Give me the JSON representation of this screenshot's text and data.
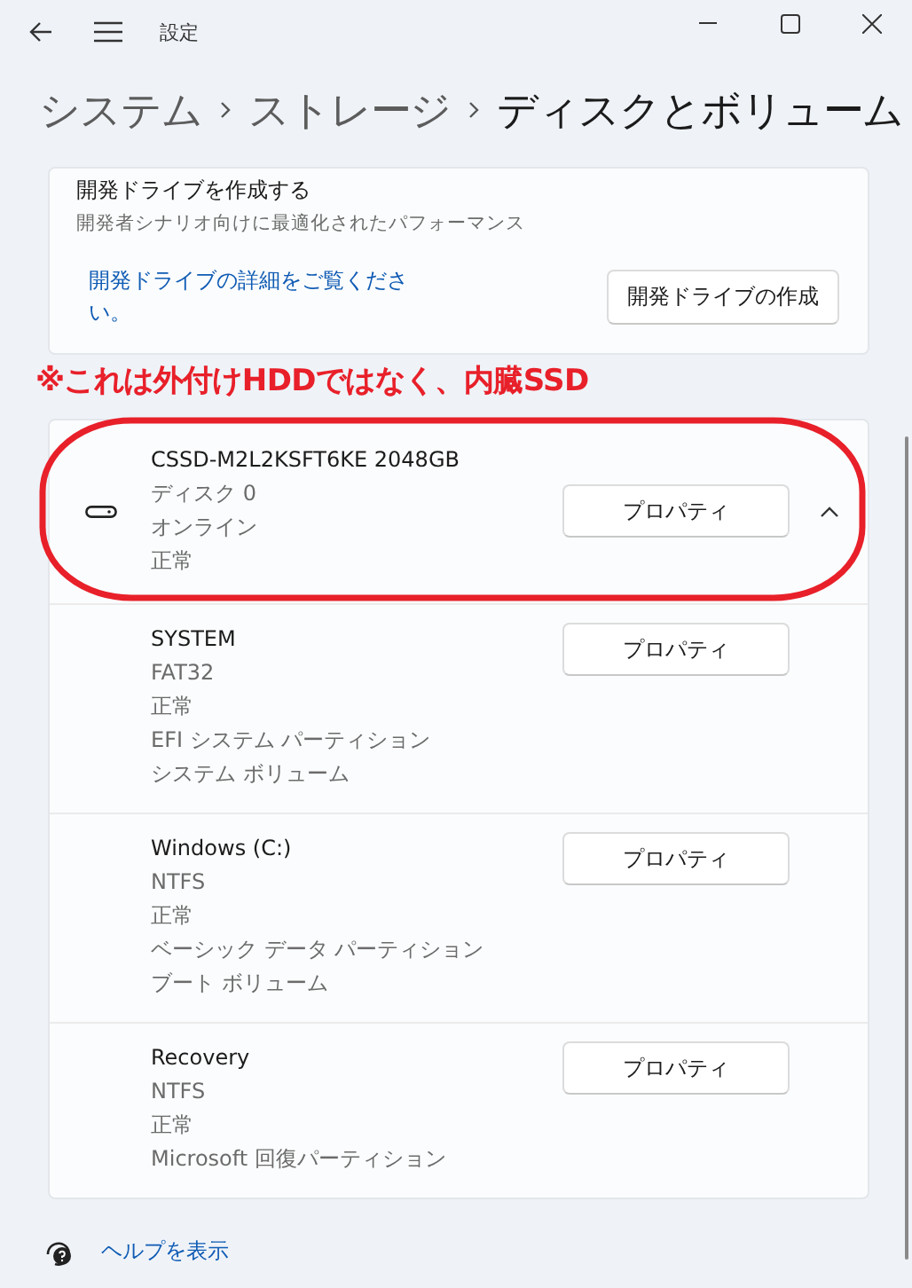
{
  "window": {
    "title": "設定"
  },
  "breadcrumb": [
    "システム",
    "ストレージ",
    "ディスクとボリューム"
  ],
  "dev_drive": {
    "title": "開発ドライブを作成する",
    "subtitle": "開発者シナリオ向けに最適化されたパフォーマンス",
    "link": "開発ドライブの詳細をご覧ください。",
    "button": "開発ドライブの作成"
  },
  "annotation": {
    "text": "※これは外付けHDDではなく、内臓SSD"
  },
  "volumes": [
    {
      "kind": "disk",
      "name": "CSSD-M2L2KSFT6KE 2048GB",
      "details": [
        "ディスク 0",
        "オンライン",
        "正常"
      ],
      "button": "プロパティ",
      "expanded": true,
      "circled": true
    },
    {
      "kind": "partition",
      "name": "SYSTEM",
      "details": [
        "FAT32",
        "正常",
        "EFI システム パーティション",
        "システム ボリューム"
      ],
      "button": "プロパティ"
    },
    {
      "kind": "partition",
      "name": "Windows (C:)",
      "details": [
        "NTFS",
        "正常",
        "ベーシック データ パーティション",
        "ブート ボリューム"
      ],
      "button": "プロパティ"
    },
    {
      "kind": "partition",
      "name": "Recovery",
      "details": [
        "NTFS",
        "正常",
        "Microsoft 回復パーティション"
      ],
      "button": "プロパティ"
    }
  ],
  "help": {
    "label": "ヘルプを表示"
  }
}
